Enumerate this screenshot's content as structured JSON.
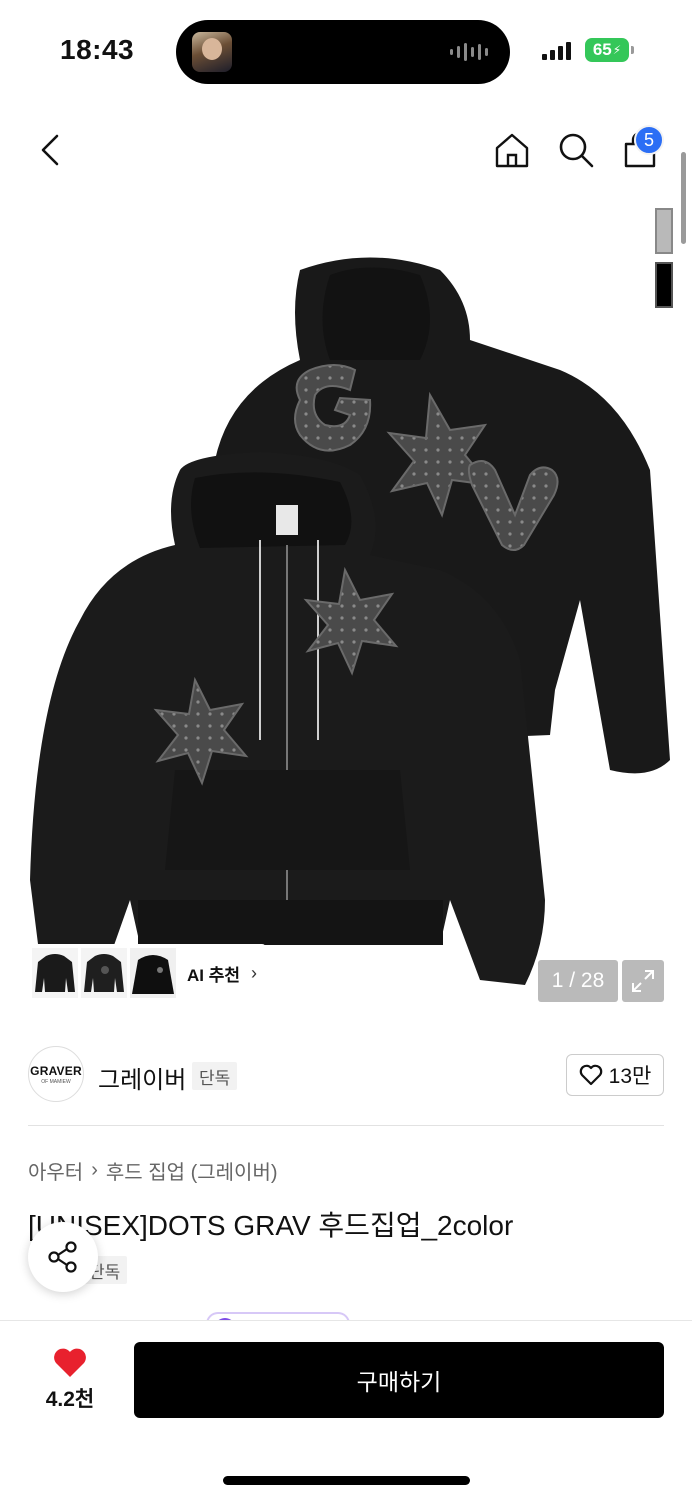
{
  "status_bar": {
    "time": "18:43",
    "battery": "65",
    "battery_color": "#34c759"
  },
  "header": {
    "back_icon": "chevron-left-icon",
    "home_icon": "home-icon",
    "search_icon": "search-icon",
    "cart_icon": "shopping-bag-icon",
    "cart_badge": "5",
    "badge_color": "#2b6ef5"
  },
  "gallery": {
    "ai_recommend_label": "AI 추천",
    "ai_chevron": "›",
    "page_counter": "1 / 28",
    "expand_icon": "expand-icon"
  },
  "brand": {
    "logo_text": "GRAVER",
    "logo_sub": "OF MAMIEW",
    "name": "그레이버",
    "tag": "단독",
    "likes": "13만"
  },
  "product": {
    "breadcrumb": [
      "아우터",
      "후드 집업 (그레이버)"
    ],
    "breadcrumb_separator": "›",
    "title": "[UNISEX]DOTS GRAV 후드집업_2color",
    "tag": "단독",
    "share_icon": "share-icon"
  },
  "bottom_bar": {
    "wish_count": "4.2천",
    "wish_color": "#e8212e",
    "buy_label": "구매하기"
  }
}
